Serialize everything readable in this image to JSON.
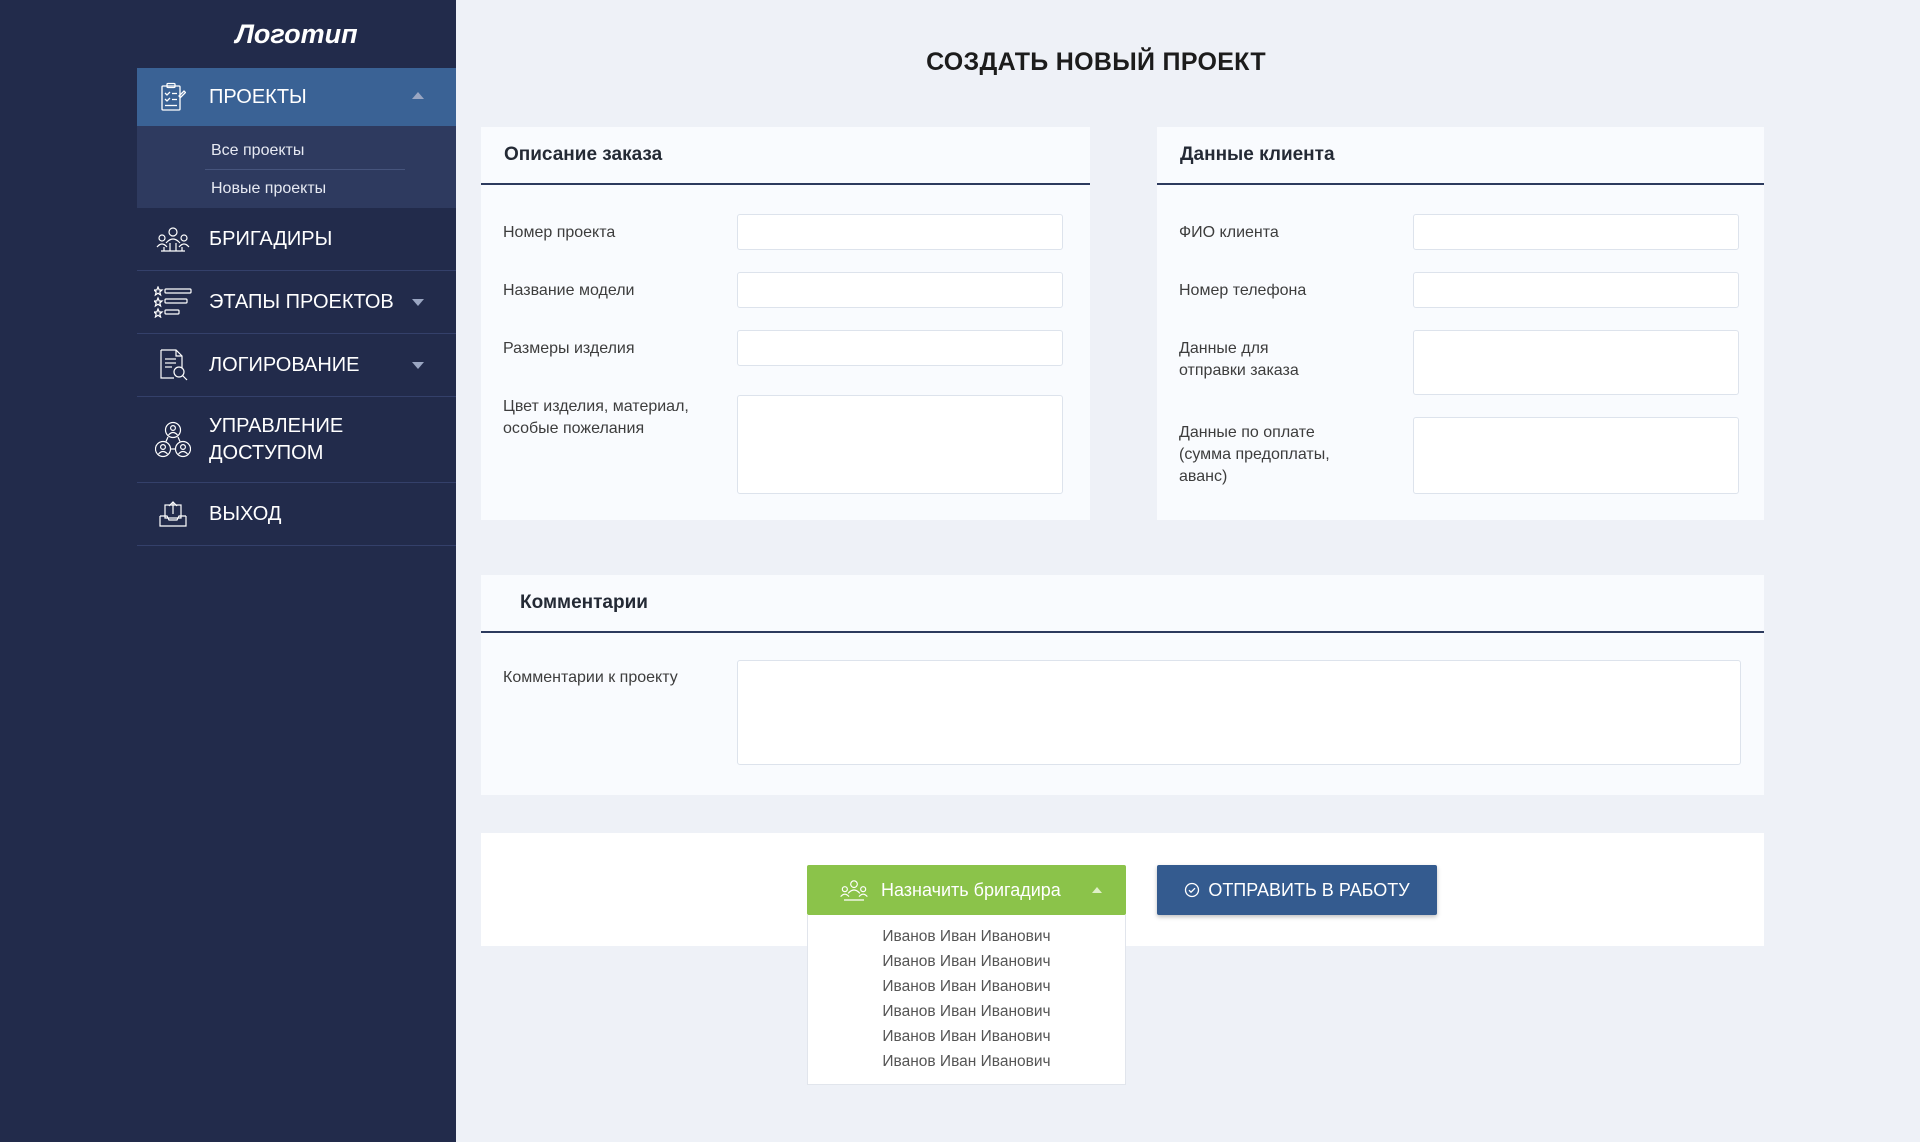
{
  "sidebar": {
    "logo": "Логотип",
    "nav": {
      "projects": {
        "label": "ПРОЕКТЫ",
        "icon": "clipboard-checklist-icon"
      },
      "projects_sub": [
        "Все проекты",
        "Новые проекты"
      ],
      "foremen": {
        "label": "БРИГАДИРЫ",
        "icon": "team-icon"
      },
      "stages": {
        "label": "ЭТАПЫ ПРОЕКТОВ",
        "icon": "star-list-icon"
      },
      "logging": {
        "label": "ЛОГИРОВАНИЕ",
        "icon": "document-search-icon"
      },
      "access": {
        "label_line1": "УПРАВЛЕНИЕ",
        "label_line2": "ДОСТУПОМ",
        "icon": "users-network-icon"
      },
      "logout": {
        "label": "ВЫХОД",
        "icon": "logout-tray-icon"
      }
    }
  },
  "page_title": "СОЗДАТЬ НОВЫЙ ПРОЕКТ",
  "order_card": {
    "title": "Описание заказа",
    "fields": {
      "project_number": "Номер проекта",
      "model_name": "Название модели",
      "product_size": "Размеры изделия",
      "color_line1": "Цвет изделия, материал,",
      "color_line2": "особые пожелания"
    }
  },
  "client_card": {
    "title": "Данные клиента",
    "fields": {
      "client_name": "ФИО клиента",
      "phone": "Номер телефона",
      "shipping_line1": "Данные для",
      "shipping_line2": "отправки заказа",
      "payment_line1": "Данные по оплате",
      "payment_line2": "(сумма предоплаты,",
      "payment_line3": "аванс)"
    }
  },
  "comments_card": {
    "title": "Комментарии",
    "field_label": "Комментарии к проекту"
  },
  "actions": {
    "assign_label": "Назначить бригадира",
    "assign_icon": "team-icon",
    "submit_label": "ОТПРАВИТЬ В РАБОТУ",
    "submit_icon": "check-circle-icon",
    "foremen_options": [
      "Иванов Иван Иванович",
      "Иванов Иван Иванович",
      "Иванов Иван Иванович",
      "Иванов Иван Иванович",
      "Иванов Иван Иванович",
      "Иванов Иван Иванович"
    ]
  },
  "colors": {
    "sidebar_bg": "#222b4b",
    "active_nav": "#3a6295",
    "green": "#8bc34a",
    "blue_button": "#345b8f"
  }
}
